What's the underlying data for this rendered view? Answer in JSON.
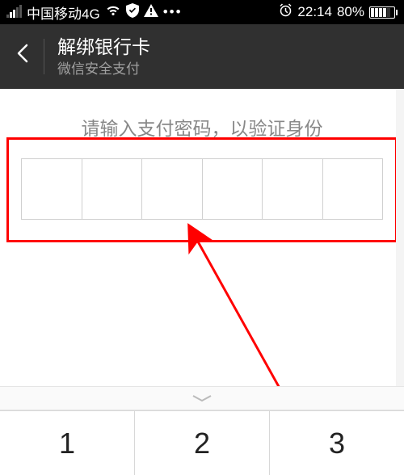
{
  "status": {
    "carrier": "中国移动4G",
    "time": "22:14",
    "battery_percent": "80%"
  },
  "header": {
    "title": "解绑银行卡",
    "subtitle": "微信安全支付"
  },
  "content": {
    "instruction": "请输入支付密码，以验证身份"
  },
  "keypad": {
    "k1": "1",
    "k2": "2",
    "k3": "3"
  }
}
